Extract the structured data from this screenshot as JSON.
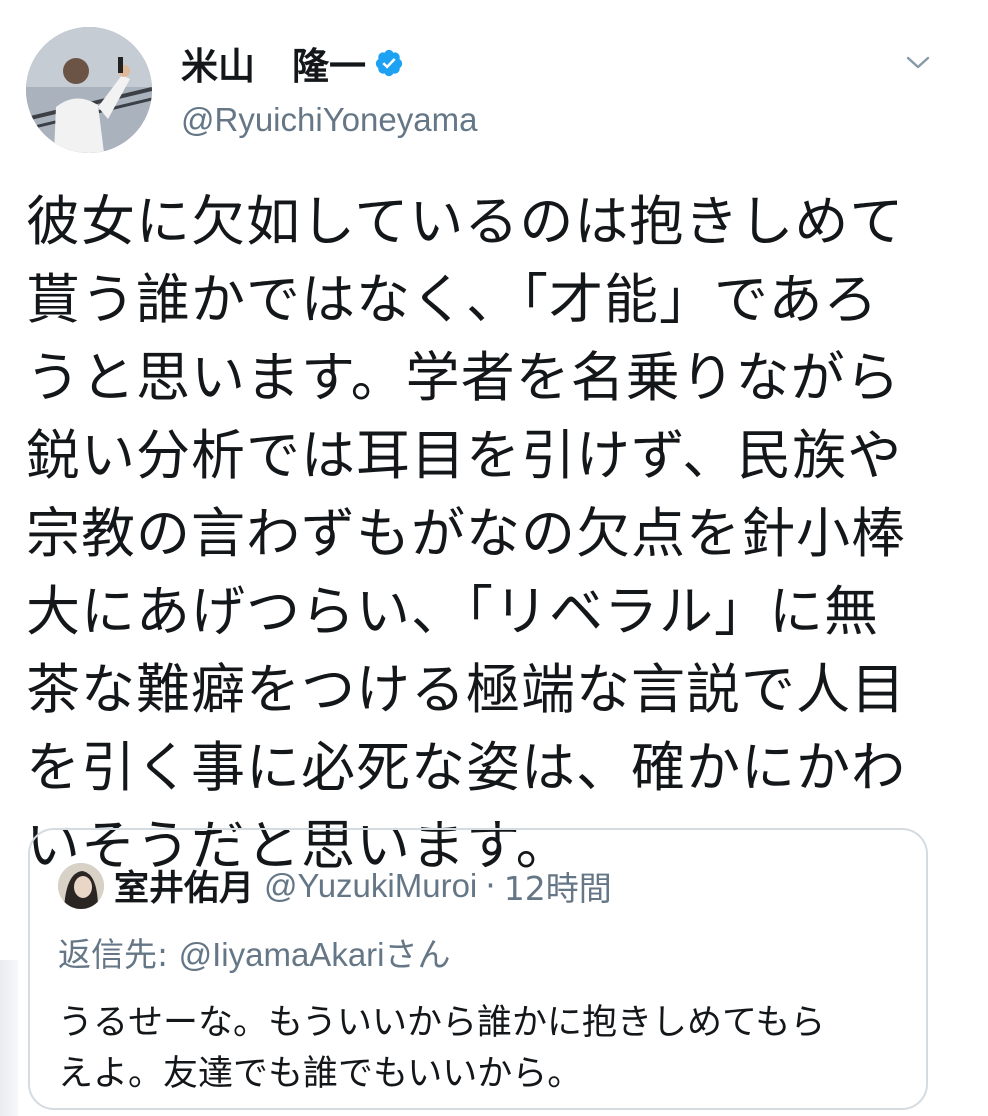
{
  "tweet": {
    "display_name": "米山　隆一",
    "handle": "@RyuichiYoneyama",
    "verified": true,
    "menu_icon": "chevron-down-icon",
    "text": "彼女に欠如しているのは抱きしめて\n貰う誰かではなく、「才能」であろ\nうと思います。学者を名乗りながら\n鋭い分析では耳目を引けず、民族や\n宗教の言わずもがなの欠点を針小棒\n大にあげつらい、「リベラル」に無\n茶な難癖をつける極端な言説で人目\nを引く事に必死な姿は、確かにかわ\nいそうだと思います。"
  },
  "quote": {
    "display_name": "室井佑月",
    "handle": "@YuzukiMuroi",
    "separator": "·",
    "time": "12時間",
    "reply_label": "返信先: ",
    "reply_user": "@IiyamaAkari",
    "reply_suffix": "さん",
    "text": "うるせーな。もういいから誰かに抱きしめてもら\nえよ。友達でも誰でもいいから。"
  },
  "colors": {
    "verified": "#1da1f2",
    "secondary_text": "#657786",
    "border": "#d4dbe1"
  }
}
